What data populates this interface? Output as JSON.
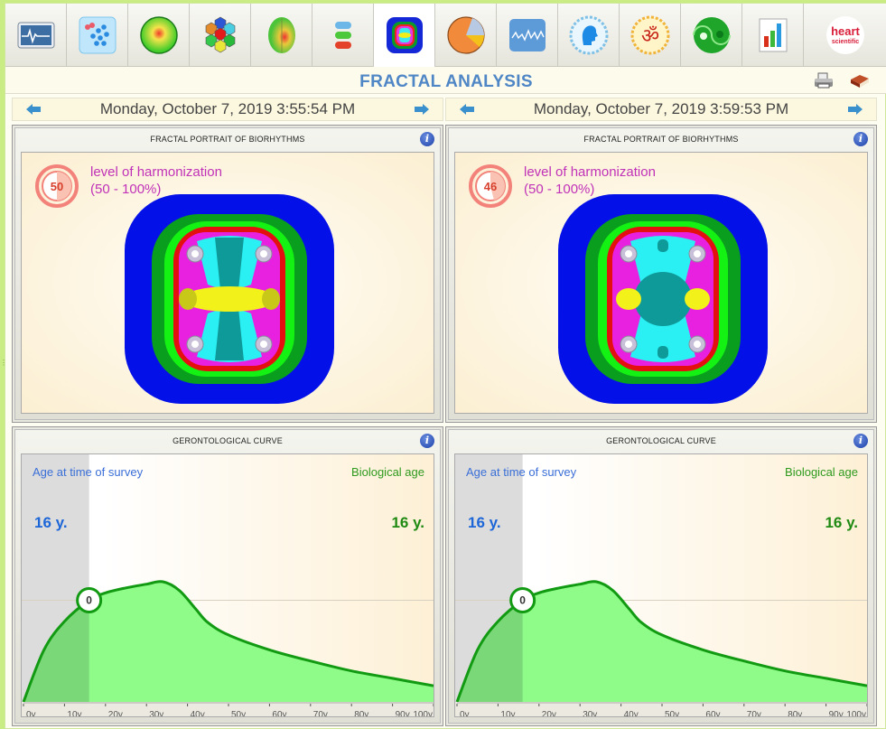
{
  "toolbar": {
    "items": [
      {
        "name": "ecg-monitor",
        "active": false
      },
      {
        "name": "scatter-analysis",
        "active": false
      },
      {
        "name": "energy-sphere",
        "active": false
      },
      {
        "name": "hexagon-matrix",
        "active": false
      },
      {
        "name": "brain-map",
        "active": false
      },
      {
        "name": "spine",
        "active": false
      },
      {
        "name": "fractal-analysis",
        "active": true
      },
      {
        "name": "pie-chart",
        "active": false
      },
      {
        "name": "wave-chart",
        "active": false
      },
      {
        "name": "head-profile",
        "active": false
      },
      {
        "name": "om-symbol",
        "active": false
      },
      {
        "name": "yin-yang",
        "active": false
      },
      {
        "name": "bar-chart",
        "active": false
      }
    ],
    "logo": {
      "line1": "heart",
      "line2": "scientific"
    }
  },
  "header": {
    "title": "FRACTAL ANALYSIS",
    "print_icon": "printer-icon",
    "help_icon": "book-icon"
  },
  "columns": [
    {
      "date": "Monday, October 7, 2019 3:55:54 PM",
      "fractal": {
        "title": "FRACTAL PORTRAIT OF BIORHYTHMS",
        "harmonization_value": "50",
        "harmonization_fraction": 0.5,
        "label_line1": "level of harmonization",
        "label_line2": "(50 - 100%)"
      },
      "curve": {
        "title": "GERONTOLOGICAL CURVE",
        "age_label": "Age at time of survey",
        "bio_label": "Biological age",
        "age_value": "16 y.",
        "bio_value": "16 y.",
        "marker": "0"
      }
    },
    {
      "date": "Monday, October 7, 2019 3:59:53 PM",
      "fractal": {
        "title": "FRACTAL PORTRAIT OF BIORHYTHMS",
        "harmonization_value": "46",
        "harmonization_fraction": 0.46,
        "label_line1": "level of harmonization",
        "label_line2": "(50 - 100%)"
      },
      "curve": {
        "title": "GERONTOLOGICAL CURVE",
        "age_label": "Age at time of survey",
        "bio_label": "Biological age",
        "age_value": "16 y.",
        "bio_value": "16 y.",
        "marker": "0"
      }
    }
  ],
  "chart_data": [
    {
      "type": "area",
      "title": "GERONTOLOGICAL CURVE",
      "xlabel": "",
      "ylabel": "",
      "x_ticks": [
        "0y",
        "10y",
        "20y",
        "30y",
        "40y",
        "50y",
        "60y",
        "70y",
        "80y",
        "90y",
        "100y"
      ],
      "xlim": [
        0,
        100
      ],
      "x": [
        0,
        5,
        10,
        16,
        20,
        25,
        30,
        34,
        38,
        42,
        45,
        50,
        60,
        70,
        80,
        90,
        100
      ],
      "y": [
        0,
        0.42,
        0.65,
        0.82,
        0.88,
        0.92,
        0.95,
        0.97,
        0.9,
        0.75,
        0.64,
        0.54,
        0.42,
        0.33,
        0.25,
        0.19,
        0.13
      ],
      "ylim": [
        0,
        1.05
      ],
      "reference_line": 0.82,
      "survey_age": 16,
      "biological_age": 16,
      "marker_label": "0"
    },
    {
      "type": "area",
      "title": "GERONTOLOGICAL CURVE",
      "xlabel": "",
      "ylabel": "",
      "x_ticks": [
        "0y",
        "10y",
        "20y",
        "30y",
        "40y",
        "50y",
        "60y",
        "70y",
        "80y",
        "90y",
        "100y"
      ],
      "xlim": [
        0,
        100
      ],
      "x": [
        0,
        5,
        10,
        16,
        20,
        25,
        30,
        34,
        38,
        42,
        45,
        50,
        60,
        70,
        80,
        90,
        100
      ],
      "y": [
        0,
        0.42,
        0.65,
        0.82,
        0.88,
        0.92,
        0.95,
        0.97,
        0.9,
        0.75,
        0.64,
        0.54,
        0.42,
        0.33,
        0.25,
        0.19,
        0.13
      ],
      "ylim": [
        0,
        1.05
      ],
      "reference_line": 0.82,
      "survey_age": 16,
      "biological_age": 16,
      "marker_label": "0"
    }
  ]
}
